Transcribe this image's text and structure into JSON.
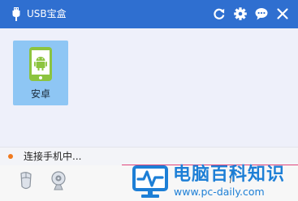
{
  "window": {
    "title": "USB宝盒",
    "title_icon": "usb-plug-icon",
    "controls": [
      {
        "name": "refresh-icon"
      },
      {
        "name": "gear-icon"
      },
      {
        "name": "chat-bubble-icon"
      },
      {
        "name": "close-icon"
      }
    ]
  },
  "devices": [
    {
      "label": "安卓",
      "icon": "android-phone-icon"
    }
  ],
  "status": {
    "text": "连接手机中...",
    "dot_color": "#f07a1e"
  },
  "bottom_icons": [
    {
      "name": "mouse-icon"
    },
    {
      "name": "webcam-icon"
    }
  ],
  "watermark": {
    "title": "电脑百科知识",
    "url": "www.pc-daily.com"
  },
  "colors": {
    "titlebar": "#2f6fd0",
    "tile": "#8ec6f4",
    "android_green": "#8cc43f",
    "watermark_blue": "#1d7fd6",
    "status_accent": "#e0457b"
  }
}
